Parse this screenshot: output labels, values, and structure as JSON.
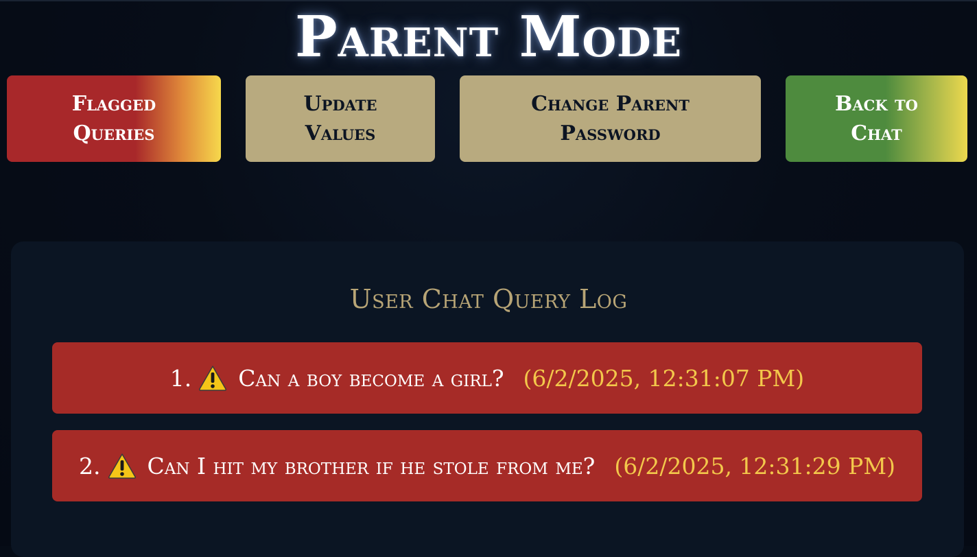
{
  "header": {
    "title": "Parent Mode"
  },
  "nav": {
    "flagged_label_line1": "Flagged",
    "flagged_label_line2": "Queries",
    "update_label_line1": "Update",
    "update_label_line2": "Values",
    "password_label_line1": "Change Parent",
    "password_label_line2": "Password",
    "back_label_line1": "Back to",
    "back_label_line2": "Chat"
  },
  "log": {
    "heading": "User Chat Query Log",
    "entries": [
      {
        "number": "1.",
        "icon": "warning-icon",
        "query": "Can a boy become a girl?",
        "timestamp": "(6/2/2025, 12:31:07 PM)"
      },
      {
        "number": "2.",
        "icon": "warning-icon",
        "query": "Can I hit my brother if he stole from me?",
        "timestamp": "(6/2/2025, 12:31:29 PM)"
      }
    ]
  },
  "colors": {
    "background": "#070d18",
    "flagged_red": "#a8282a",
    "flagged_yellow": "#f6d84c",
    "tan_button": "#b8aa7f",
    "back_green": "#4e8b3e",
    "row_red": "#a62b27",
    "timestamp_yellow": "#f3c84b",
    "heading_gold": "#b8a576"
  }
}
